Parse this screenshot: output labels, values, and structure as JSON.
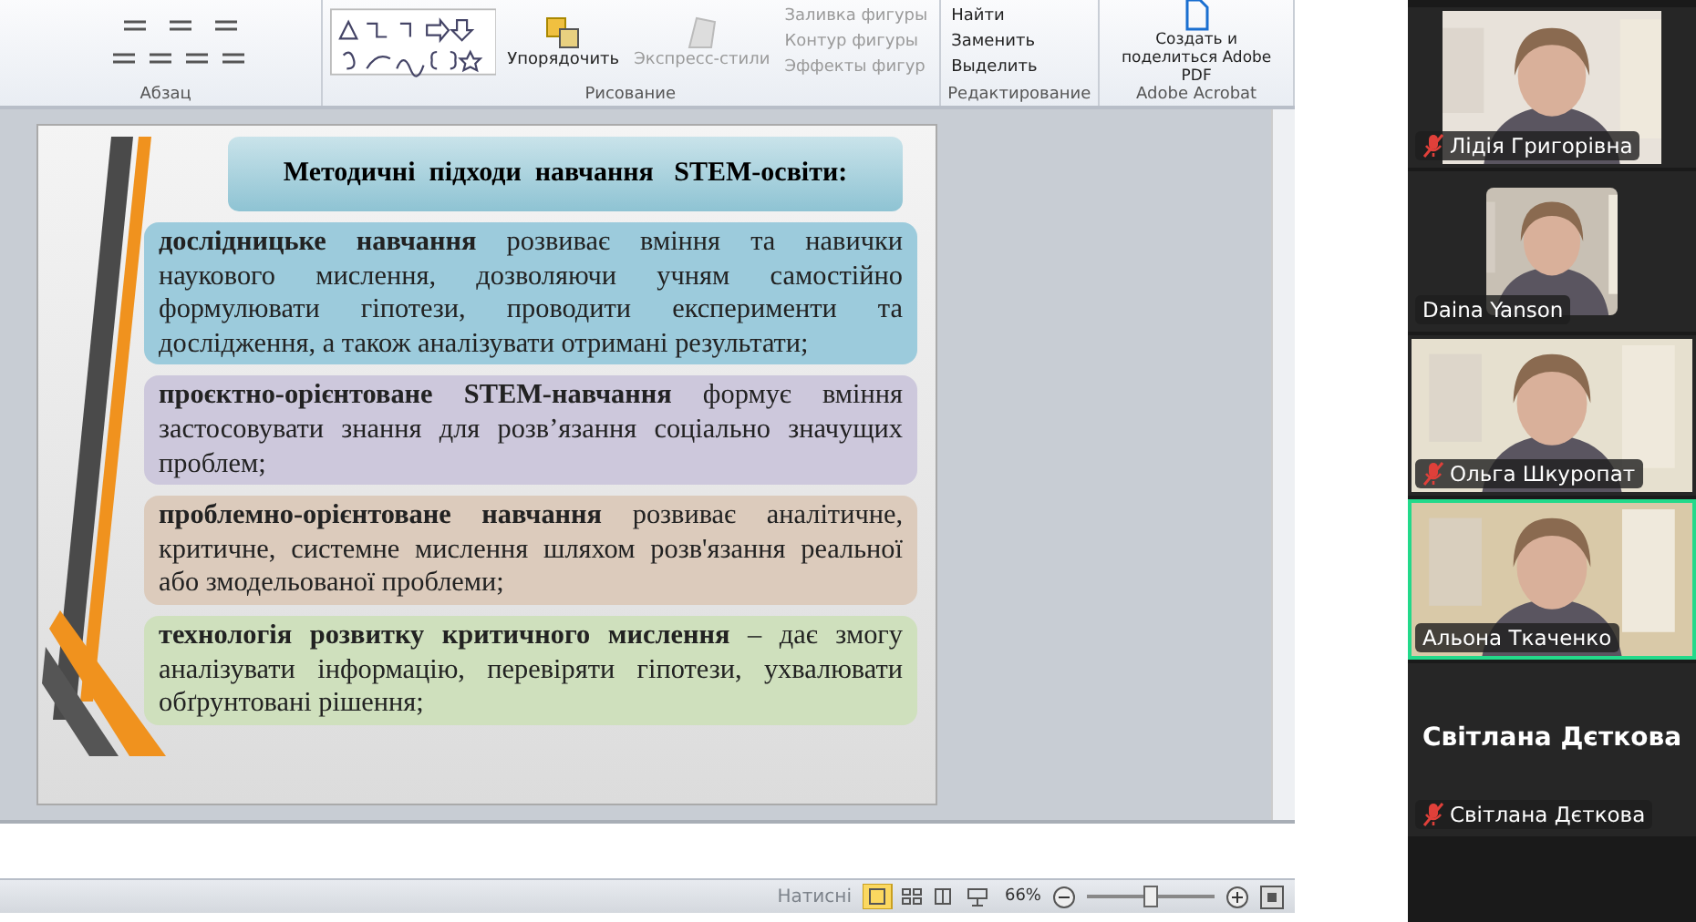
{
  "ribbon": {
    "groups": [
      {
        "kind": "paragraph",
        "label": "Абзац"
      },
      {
        "kind": "drawing",
        "label": "Рисование",
        "buttons": [
          "Упорядочить",
          "Экспресс-стили"
        ],
        "shape_commands": [
          "Заливка фигуры",
          "Контур фигуры",
          "Эффекты фигур"
        ]
      },
      {
        "kind": "editing",
        "label": "Редактирование",
        "commands": [
          "Найти",
          "Заменить",
          "Выделить"
        ]
      },
      {
        "kind": "acrobat",
        "label": "Adobe Acrobat",
        "button": "Создать и поделиться Adobe PDF"
      }
    ]
  },
  "slide": {
    "title": "Методичні  підходи  навчання   STEM-освіти:",
    "paragraphs": [
      {
        "text": "**дослідницьке навчання** розвиває вміння та навички наукового мислення, дозволяючи учням самостійно формулювати гіпотези, проводити експерименти та дослідження, а також аналізувати отримані результати;",
        "color": "#9ccbdc"
      },
      {
        "text": "**проєктно-орієнтоване STEM-навчання** формує вміння застосовувати знання для розв’язання соціально значущих проблем;",
        "color": "#cdc8dc"
      },
      {
        "text": "**проблемно-орієнтоване навчання** розвиває аналітичне, критичне, системне мислення шляхом розв'язання реальної або змодельованої проблеми;",
        "color": "#dccbbc"
      },
      {
        "text": "**технологія розвитку критичного мислення** – дає змогу аналізувати інформацію, перевіряти гіпотези, ухвалювати обґрунтовані рішення;",
        "color": "#cfe0bd"
      }
    ]
  },
  "status_bar": {
    "hint": "Натисні",
    "zoom": "66%",
    "level": 0.5
  },
  "participants": [
    {
      "name": "Лідія Григорівна",
      "muted": true,
      "speaking": false,
      "kind": "video"
    },
    {
      "name": "Daina Yanson",
      "muted": false,
      "speaking": false
    },
    {
      "name": "Ольга Шкуропат",
      "muted": true,
      "speaking": false,
      "kind": "video"
    },
    {
      "name": "Альона Ткаченко",
      "muted": false,
      "speaking": true,
      "kind": "video"
    },
    {
      "name": "Світлана Дєткова",
      "muted": true,
      "speaking": false,
      "kind": "off",
      "big_name": "Світлана Дєткова"
    }
  ]
}
